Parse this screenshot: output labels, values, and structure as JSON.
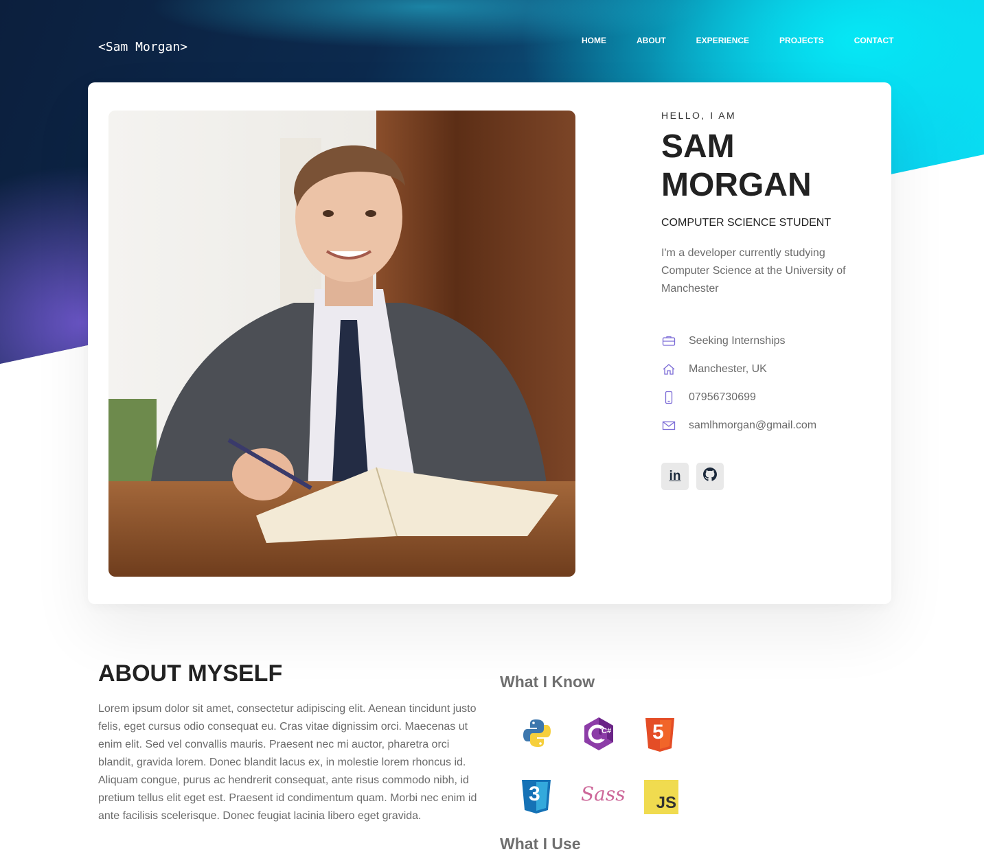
{
  "header": {
    "logo": "<Sam Morgan>",
    "nav": [
      "HOME",
      "ABOUT",
      "EXPERIENCE",
      "PROJECTS",
      "CONTACT"
    ]
  },
  "profile": {
    "greeting": "HELLO, I AM",
    "name_line1": "SAM",
    "name_line2": "MORGAN",
    "role": "COMPUTER SCIENCE STUDENT",
    "bio": "I'm a developer currently studying Computer Science at the University of Manchester",
    "contacts": [
      {
        "icon": "briefcase-icon",
        "text": "Seeking Internships"
      },
      {
        "icon": "home-icon",
        "text": "Manchester, UK"
      },
      {
        "icon": "phone-icon",
        "text": "07956730699"
      },
      {
        "icon": "mail-icon",
        "text": "samlhmorgan@gmail.com"
      }
    ],
    "socials": [
      {
        "icon": "linkedin-icon",
        "label": "in"
      },
      {
        "icon": "github-icon"
      }
    ]
  },
  "about": {
    "title": "ABOUT MYSELF",
    "text": "Lorem ipsum dolor sit amet, consectetur adipiscing elit. Aenean tincidunt justo felis, eget cursus odio consequat eu. Cras vitae dignissim orci. Maecenas ut enim elit. Sed vel convallis mauris. Praesent nec mi auctor, pharetra orci blandit, gravida lorem. Donec blandit lacus ex, in molestie lorem rhoncus id. Aliquam congue, purus ac hendrerit consequat, ante risus commodo nibh, id pretium tellus elit eget est. Praesent id condimentum quam. Morbi nec enim id ante facilisis scelerisque. Donec feugiat lacinia libero eget gravida."
  },
  "skills": {
    "know_title": "What I Know",
    "use_title": "What I Use",
    "items": [
      {
        "icon": "python-icon"
      },
      {
        "icon": "csharp-icon",
        "label": "C#"
      },
      {
        "icon": "html5-icon",
        "label": "5"
      },
      {
        "icon": "css3-icon",
        "label": "3"
      },
      {
        "icon": "sass-icon",
        "label": "Sass"
      },
      {
        "icon": "javascript-icon",
        "label": "JS"
      }
    ]
  },
  "colors": {
    "accent": "#7b6bd6",
    "dark_text": "#222222",
    "muted_text": "#6b6b6b",
    "social_bg": "#e9e9e9"
  }
}
